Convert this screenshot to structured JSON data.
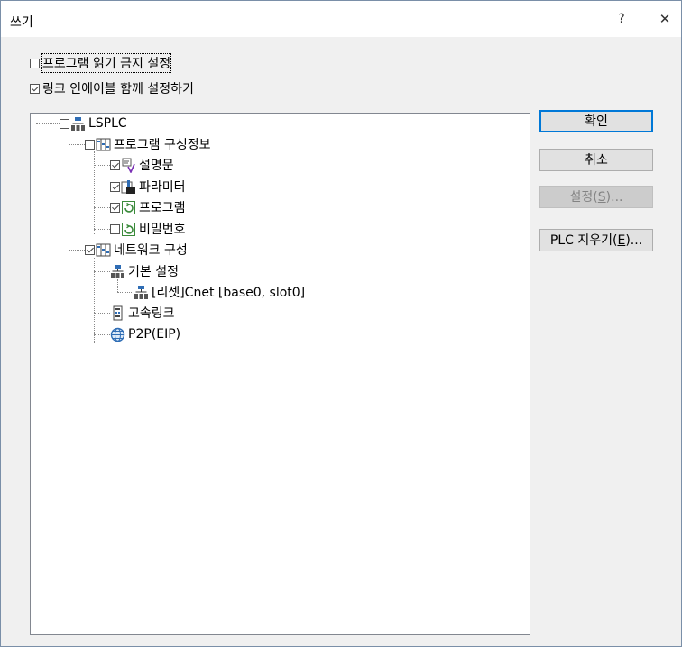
{
  "window": {
    "title": "쓰기",
    "help_label": "?",
    "close_label": "✕"
  },
  "options": {
    "prohibit_read": {
      "label": "프로그램 읽기 금지 설정",
      "checked": false
    },
    "link_enable": {
      "label": "링크 인에이블 함께 설정하기",
      "checked": true
    }
  },
  "tree": {
    "root": {
      "label": "LSPLC",
      "checked": false,
      "icon": "plc-network-icon"
    },
    "program_config": {
      "label": "프로그램 구성정보",
      "checked": false,
      "icon": "grid-icon"
    },
    "description": {
      "label": "설명문",
      "checked": true,
      "icon": "comment-icon"
    },
    "parameter": {
      "label": "파라미터",
      "checked": true,
      "icon": "parameter-hand-icon"
    },
    "program": {
      "label": "프로그램",
      "checked": true,
      "icon": "program-icon"
    },
    "password": {
      "label": "비밀번호",
      "checked": false,
      "icon": "program-icon"
    },
    "network_config": {
      "label": "네트워크 구성",
      "checked": true,
      "icon": "grid-icon"
    },
    "basic_settings": {
      "label": "기본 설정",
      "icon": "plc-network-icon"
    },
    "cnet_slot": {
      "label": "[리셋]Cnet [base0, slot0]",
      "icon": "plc-network-icon"
    },
    "highspeed_link": {
      "label": "고속링크",
      "icon": "module-icon"
    },
    "p2p": {
      "label": "P2P(EIP)",
      "icon": "globe-icon"
    }
  },
  "buttons": {
    "ok": {
      "label": "확인"
    },
    "cancel": {
      "label": "취소"
    },
    "settings": {
      "pre": "설정(",
      "key": "S",
      "post": ")..."
    },
    "plc_erase": {
      "pre": "PLC 지우기(",
      "key": "E",
      "post": ")..."
    }
  }
}
